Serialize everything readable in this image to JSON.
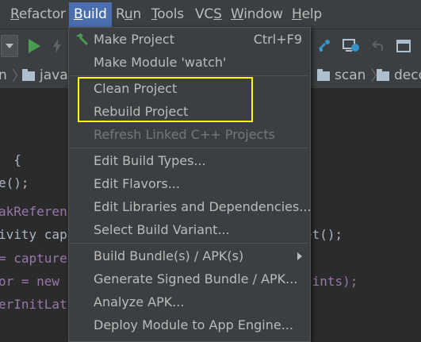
{
  "menubar": {
    "items": [
      {
        "label": "Refactor",
        "mnemonic": "R"
      },
      {
        "label": "Build",
        "mnemonic": "B"
      },
      {
        "label": "Run",
        "mnemonic": "u"
      },
      {
        "label": "Tools",
        "mnemonic": "T"
      },
      {
        "label": "VCS",
        "mnemonic": "S"
      },
      {
        "label": "Window",
        "mnemonic": "W"
      },
      {
        "label": "Help",
        "mnemonic": "H"
      }
    ]
  },
  "breadcrumb": {
    "left_partial": "n",
    "java": "java",
    "scan": "scan",
    "deco": "deco"
  },
  "editor": {
    "lines": [
      "  {",
      "e();",
      "akReferen",
      "ivity cap",
      "= capture",
      "or = new I",
      "erInitLat"
    ],
    "right_fragments": [
      "et();",
      "hints);"
    ]
  },
  "build_menu": {
    "make_project": {
      "label": "Make Project",
      "shortcut": "Ctrl+F9"
    },
    "make_module": {
      "label": "Make Module 'watch'"
    },
    "clean_project": {
      "label": "Clean Project"
    },
    "rebuild_project": {
      "label": "Rebuild Project"
    },
    "refresh_cpp": {
      "label": "Refresh Linked C++ Projects"
    },
    "edit_build_types": {
      "label": "Edit Build Types..."
    },
    "edit_flavors": {
      "label": "Edit Flavors..."
    },
    "edit_libraries": {
      "label": "Edit Libraries and Dependencies..."
    },
    "select_variant": {
      "label": "Select Build Variant..."
    },
    "build_bundle": {
      "label": "Build Bundle(s) / APK(s)"
    },
    "generate_signed": {
      "label": "Generate Signed Bundle / APK..."
    },
    "analyze_apk": {
      "label": "Analyze APK..."
    },
    "deploy_module": {
      "label": "Deploy Module to App Engine..."
    }
  },
  "colors": {
    "menu_bg": "#3c3f41",
    "active_menu": "#4b6eaf",
    "highlight_box": "#ffff00",
    "editor_bg": "#2b2b2b",
    "run_green": "#499c54"
  }
}
